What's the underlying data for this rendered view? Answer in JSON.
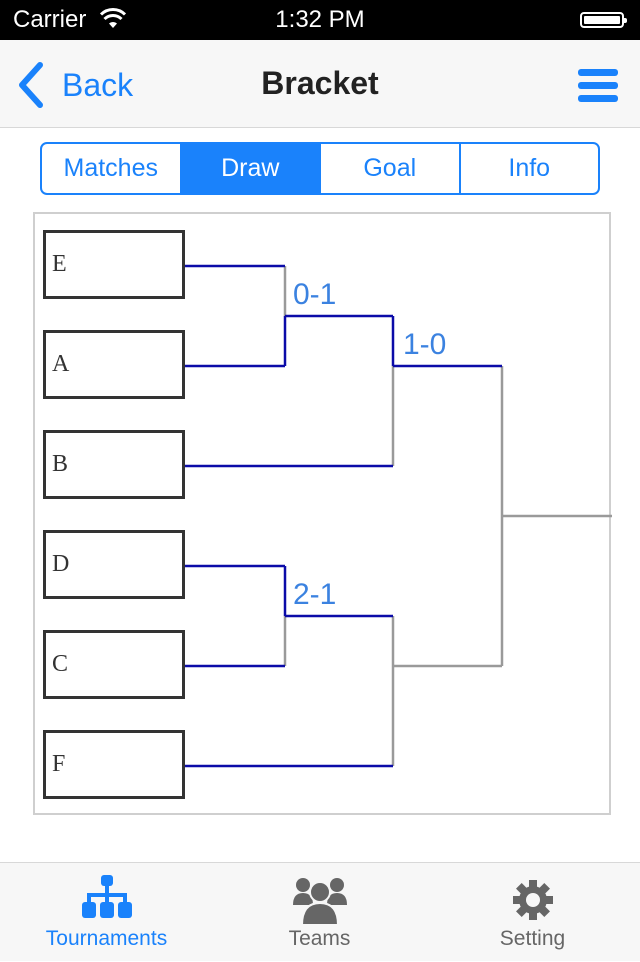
{
  "status_bar": {
    "carrier": "Carrier",
    "time": "1:32 PM"
  },
  "nav": {
    "back_label": "Back",
    "title": "Bracket"
  },
  "segments": [
    {
      "label": "Matches",
      "active": false
    },
    {
      "label": "Draw",
      "active": true
    },
    {
      "label": "Goal",
      "active": false
    },
    {
      "label": "Info",
      "active": false
    }
  ],
  "bracket": {
    "teams": [
      "E",
      "A",
      "B",
      "D",
      "C",
      "F"
    ],
    "scores": {
      "round1_top": "0-1",
      "round2_top": "1-0",
      "round1_bottom": "2-1"
    },
    "colors": {
      "winner_line": "#0b0ba8",
      "pending_line": "#9a9a9a",
      "score": "#3b82e0"
    }
  },
  "tabbar": {
    "items": [
      {
        "label": "Tournaments",
        "icon": "tournament-tree-icon",
        "active": true
      },
      {
        "label": "Teams",
        "icon": "team-group-icon",
        "active": false
      },
      {
        "label": "Setting",
        "icon": "gear-icon",
        "active": false
      }
    ]
  },
  "colors": {
    "accent": "#1a82fb",
    "inactive": "#666666"
  }
}
